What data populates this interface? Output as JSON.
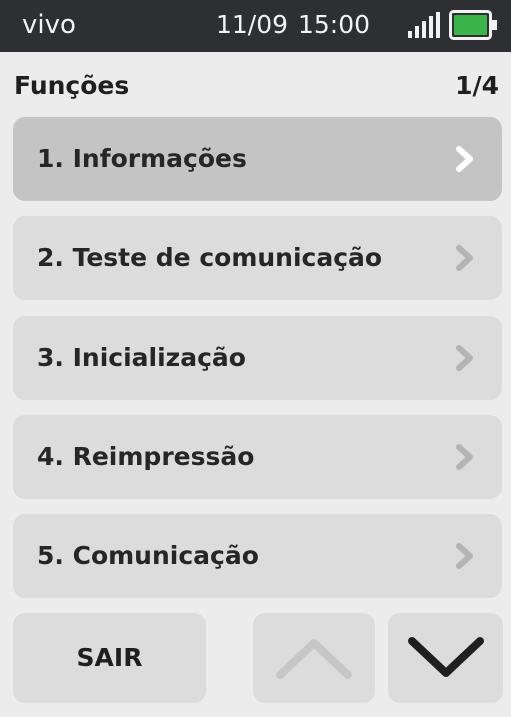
{
  "status_bar": {
    "carrier": "vivo",
    "date": "11/09",
    "time": "15:00",
    "signal_icon": "signal-bars-icon",
    "battery_icon": "battery-icon",
    "battery_color": "#3bb54a"
  },
  "header": {
    "title": "Funções",
    "page_indicator": "1/4"
  },
  "menu": {
    "items": [
      {
        "label": "1. Informações",
        "selected": true
      },
      {
        "label": "2. Teste de comunicação",
        "selected": false
      },
      {
        "label": "3. Inicialização",
        "selected": false
      },
      {
        "label": "4. Reimpressão",
        "selected": false
      },
      {
        "label": "5. Comunicação",
        "selected": false
      }
    ],
    "chevron_icon": "chevron-right-icon"
  },
  "footer": {
    "exit_label": "SAIR",
    "up_icon": "chevron-up-icon",
    "down_icon": "chevron-down-icon"
  },
  "colors": {
    "status_bar_bg": "#2e2f33",
    "screen_bg": "#ececec",
    "item_bg": "#dcdcdc",
    "item_selected_bg": "#c4c4c4",
    "chevron_active": "#ffffff",
    "chevron_inactive": "#b4b4b4",
    "arrow_disabled": "#c6c6c6",
    "arrow_enabled": "#1f1f1f"
  }
}
